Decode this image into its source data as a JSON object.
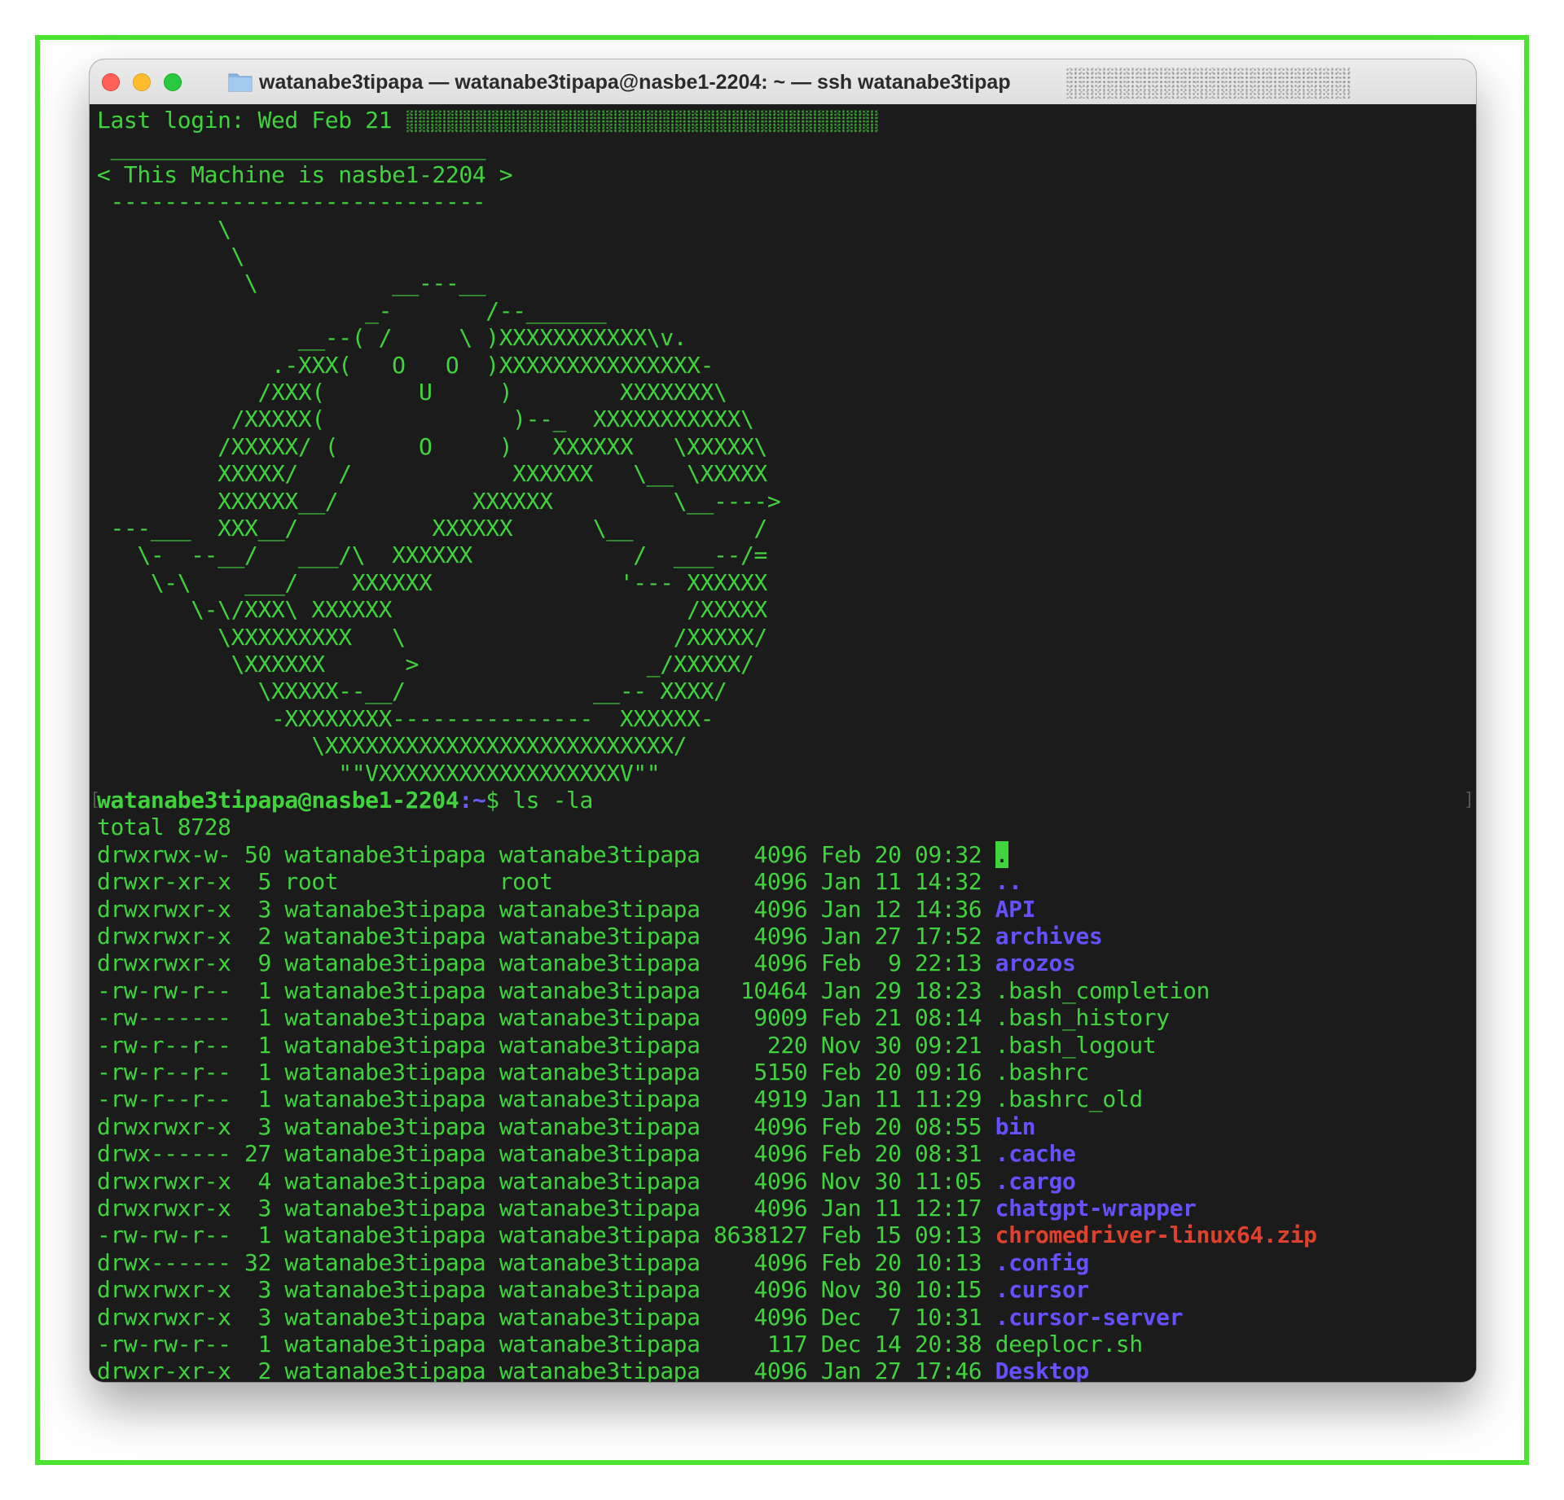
{
  "window": {
    "title": "watanabe3tipapa — watanabe3tipapa@nasbe1-2204: ~ — ssh watanabe3tipap"
  },
  "terminal": {
    "last_login": "Last login: Wed Feb 21",
    "banner": [
      " ____________________________",
      "< This Machine is nasbe1-2204 >",
      " ----------------------------",
      "         \\",
      "          \\",
      "           \\          __---__",
      "                    _-       /--______",
      "               __--( /     \\ )XXXXXXXXXXX\\v.",
      "             .-XXX(   O   O  )XXXXXXXXXXXXXXX-",
      "            /XXX(       U     )        XXXXXXX\\",
      "          /XXXXX(              )--_  XXXXXXXXXXX\\",
      "         /XXXXX/ (      O     )   XXXXXX   \\XXXXX\\",
      "         XXXXX/   /            XXXXXX   \\__ \\XXXXX",
      "         XXXXXX__/          XXXXXX         \\__---->",
      " ---___  XXX__/          XXXXXX      \\__         /",
      "   \\-  --__/   ___/\\  XXXXXX            /  ___--/=",
      "    \\-\\    ___/    XXXXXX              '--- XXXXXX",
      "       \\-\\/XXX\\ XXXXXX                      /XXXXX",
      "         \\XXXXXXXXX   \\                    /XXXXX/",
      "          \\XXXXXX      >                 _/XXXXX/",
      "            \\XXXXX--__/              __-- XXXX/",
      "             -XXXXXXXX---------------  XXXXXX-",
      "                \\XXXXXXXXXXXXXXXXXXXXXXXXXX/",
      "                  \"\"VXXXXXXXXXXXXXXXXXXV\"\""
    ],
    "prompt_user_host": "watanabe3tipapa@nasbe1-2204",
    "prompt_sep": ":",
    "prompt_path": "~",
    "prompt_dollar": "$ ",
    "command": "ls -la",
    "total": "total 8728",
    "entries": [
      {
        "meta": "drwxrwx-w- 50 watanabe3tipapa watanabe3tipapa    4096 Feb 20 09:32 ",
        "name": ".",
        "kind": "cursor"
      },
      {
        "meta": "drwxr-xr-x  5 root            root               4096 Jan 11 14:32 ",
        "name": "..",
        "kind": "dir"
      },
      {
        "meta": "drwxrwxr-x  3 watanabe3tipapa watanabe3tipapa    4096 Jan 12 14:36 ",
        "name": "API",
        "kind": "dir"
      },
      {
        "meta": "drwxrwxr-x  2 watanabe3tipapa watanabe3tipapa    4096 Jan 27 17:52 ",
        "name": "archives",
        "kind": "dir"
      },
      {
        "meta": "drwxrwxr-x  9 watanabe3tipapa watanabe3tipapa    4096 Feb  9 22:13 ",
        "name": "arozos",
        "kind": "dir"
      },
      {
        "meta": "-rw-rw-r--  1 watanabe3tipapa watanabe3tipapa   10464 Jan 29 18:23 ",
        "name": ".bash_completion",
        "kind": "file"
      },
      {
        "meta": "-rw-------  1 watanabe3tipapa watanabe3tipapa    9009 Feb 21 08:14 ",
        "name": ".bash_history",
        "kind": "file"
      },
      {
        "meta": "-rw-r--r--  1 watanabe3tipapa watanabe3tipapa     220 Nov 30 09:21 ",
        "name": ".bash_logout",
        "kind": "file"
      },
      {
        "meta": "-rw-r--r--  1 watanabe3tipapa watanabe3tipapa    5150 Feb 20 09:16 ",
        "name": ".bashrc",
        "kind": "file"
      },
      {
        "meta": "-rw-r--r--  1 watanabe3tipapa watanabe3tipapa    4919 Jan 11 11:29 ",
        "name": ".bashrc_old",
        "kind": "file"
      },
      {
        "meta": "drwxrwxr-x  3 watanabe3tipapa watanabe3tipapa    4096 Feb 20 08:55 ",
        "name": "bin",
        "kind": "dir"
      },
      {
        "meta": "drwx------ 27 watanabe3tipapa watanabe3tipapa    4096 Feb 20 08:31 ",
        "name": ".cache",
        "kind": "dir"
      },
      {
        "meta": "drwxrwxr-x  4 watanabe3tipapa watanabe3tipapa    4096 Nov 30 11:05 ",
        "name": ".cargo",
        "kind": "dir"
      },
      {
        "meta": "drwxrwxr-x  3 watanabe3tipapa watanabe3tipapa    4096 Jan 11 12:17 ",
        "name": "chatgpt-wrapper",
        "kind": "dir"
      },
      {
        "meta": "-rw-rw-r--  1 watanabe3tipapa watanabe3tipapa 8638127 Feb 15 09:13 ",
        "name": "chromedriver-linux64.zip",
        "kind": "zip"
      },
      {
        "meta": "drwx------ 32 watanabe3tipapa watanabe3tipapa    4096 Feb 20 10:13 ",
        "name": ".config",
        "kind": "dir"
      },
      {
        "meta": "drwxrwxr-x  3 watanabe3tipapa watanabe3tipapa    4096 Nov 30 10:15 ",
        "name": ".cursor",
        "kind": "dir"
      },
      {
        "meta": "drwxrwxr-x  3 watanabe3tipapa watanabe3tipapa    4096 Dec  7 10:31 ",
        "name": ".cursor-server",
        "kind": "dir"
      },
      {
        "meta": "-rw-rw-r--  1 watanabe3tipapa watanabe3tipapa     117 Dec 14 20:38 ",
        "name": "deeplocr.sh",
        "kind": "file"
      },
      {
        "meta": "drwxr-xr-x  2 watanabe3tipapa watanabe3tipapa    4096 Jan 27 17:46 ",
        "name": "Desktop",
        "kind": "dir"
      }
    ]
  },
  "colors": {
    "terminal_bg": "#1b1b1b",
    "text_green": "#3fd43c",
    "dir_purple": "#6650ff",
    "zip_red": "#e0412c",
    "frame_green": "#4ce232"
  },
  "icons": [
    "close-button",
    "minimize-button",
    "zoom-button",
    "folder-icon"
  ]
}
